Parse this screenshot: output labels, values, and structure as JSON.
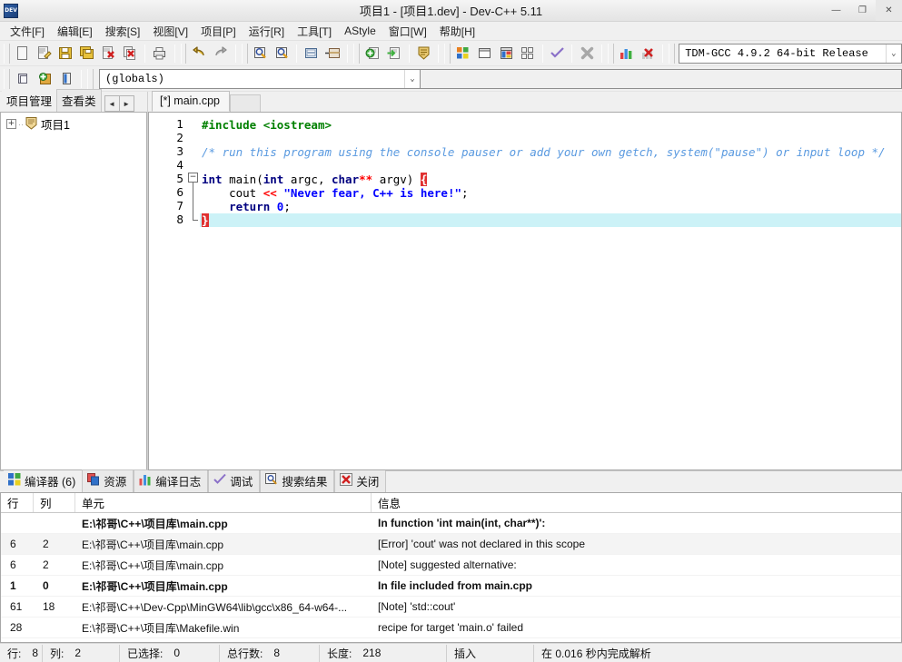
{
  "window": {
    "title": "项目1 - [项目1.dev] - Dev-C++ 5.11",
    "minimize": "—",
    "maximize": "❐",
    "close": "✕",
    "app_icon_text": "DEV"
  },
  "menubar": {
    "items": [
      {
        "label": "文件[F]",
        "name": "menu-file"
      },
      {
        "label": "编辑[E]",
        "name": "menu-edit"
      },
      {
        "label": "搜索[S]",
        "name": "menu-search"
      },
      {
        "label": "视图[V]",
        "name": "menu-view"
      },
      {
        "label": "项目[P]",
        "name": "menu-project"
      },
      {
        "label": "运行[R]",
        "name": "menu-run"
      },
      {
        "label": "工具[T]",
        "name": "menu-tools"
      },
      {
        "label": "AStyle",
        "name": "menu-astyle"
      },
      {
        "label": "窗口[W]",
        "name": "menu-window"
      },
      {
        "label": "帮助[H]",
        "name": "menu-help"
      }
    ]
  },
  "toolbar": {
    "compiler_combo_value": "TDM-GCC 4.9.2 64-bit Release",
    "globals_combo_value": "(globals)",
    "dropdown_arrow": "⌄",
    "icons": [
      "new-file-icon",
      "open-file-icon",
      "save-icon",
      "save-all-icon",
      "close-file-icon",
      "close-all-icon",
      "print-icon",
      "undo-icon",
      "redo-icon",
      "find-icon",
      "replace-icon",
      "goto-line-icon",
      "goto-function-icon",
      "add-to-project-icon",
      "remove-from-project-icon",
      "project-options-icon",
      "compile-icon",
      "run-icon",
      "compile-and-run-icon",
      "rebuild-all-icon",
      "syntax-check-icon",
      "stop-execution-icon",
      "profile-icon",
      "delete-profile-icon"
    ],
    "row2_icons": [
      "new-project-icon",
      "insert-icon",
      "toggle-icon"
    ]
  },
  "left_panel": {
    "tabs": [
      {
        "label": "项目管理",
        "name": "tab-project-manager",
        "active": true
      },
      {
        "label": "查看类",
        "name": "tab-class-browser",
        "active": false
      }
    ],
    "nav_prev": "◄",
    "nav_next": "►",
    "tree": {
      "expander": "+",
      "icon": "project-shield-icon",
      "label": "项目1"
    }
  },
  "editor": {
    "tabs": [
      {
        "label": "[*] main.cpp",
        "name": "tab-main-cpp",
        "active": true
      }
    ],
    "fold_collapse_glyph": "−",
    "lines": [
      {
        "number": "1",
        "selected": false,
        "tokens": [
          {
            "text": "#include ",
            "cls": "pre"
          },
          {
            "text": "<iostream>",
            "cls": "pre"
          }
        ]
      },
      {
        "number": "2",
        "selected": false,
        "tokens": []
      },
      {
        "number": "3",
        "selected": false,
        "tokens": [
          {
            "text": "/* run this program using the console pauser or add your own getch, system(\"pause\") or input loop */",
            "cls": "cmt"
          }
        ]
      },
      {
        "number": "4",
        "selected": false,
        "tokens": []
      },
      {
        "number": "5",
        "selected": false,
        "tokens": [
          {
            "text": "int",
            "cls": "kw"
          },
          {
            "text": " main(",
            "cls": "plain"
          },
          {
            "text": "int",
            "cls": "kw"
          },
          {
            "text": " argc, ",
            "cls": "plain"
          },
          {
            "text": "char",
            "cls": "kw"
          },
          {
            "text": "**",
            "cls": "op"
          },
          {
            "text": " argv) ",
            "cls": "plain"
          },
          {
            "text": "{",
            "cls": "brace"
          }
        ]
      },
      {
        "number": "6",
        "selected": false,
        "tokens": [
          {
            "text": "    cout ",
            "cls": "plain"
          },
          {
            "text": "<<",
            "cls": "op"
          },
          {
            "text": " ",
            "cls": "plain"
          },
          {
            "text": "\"Never fear, C++ is here!\"",
            "cls": "str"
          },
          {
            "text": ";",
            "cls": "plain"
          }
        ]
      },
      {
        "number": "7",
        "selected": false,
        "tokens": [
          {
            "text": "    ",
            "cls": "plain"
          },
          {
            "text": "return",
            "cls": "kw"
          },
          {
            "text": " ",
            "cls": "plain"
          },
          {
            "text": "0",
            "cls": "num"
          },
          {
            "text": ";",
            "cls": "plain"
          }
        ]
      },
      {
        "number": "8",
        "selected": true,
        "tokens": [
          {
            "text": "}",
            "cls": "brace"
          }
        ]
      }
    ]
  },
  "bottom_panel": {
    "tabs": [
      {
        "label": "编译器 (6)",
        "icon": "compiler-grid-icon",
        "name": "tab-compiler",
        "active": true
      },
      {
        "label": "资源",
        "icon": "resources-icon",
        "name": "tab-resources",
        "active": false
      },
      {
        "label": "编译日志",
        "icon": "compile-log-icon",
        "name": "tab-compile-log",
        "active": false
      },
      {
        "label": "调试",
        "icon": "debug-check-icon",
        "name": "tab-debug",
        "active": false
      },
      {
        "label": "搜索结果",
        "icon": "search-results-icon",
        "name": "tab-search-results",
        "active": false
      },
      {
        "label": "关闭",
        "icon": "close-panel-icon",
        "name": "tab-close",
        "active": false
      }
    ],
    "columns": [
      "行",
      "列",
      "单元",
      "信息"
    ],
    "rows": [
      {
        "line": "",
        "col": "",
        "unit": "E:\\祁哥\\C++\\项目库\\main.cpp",
        "message": "In function 'int main(int, char**)':",
        "bold": true,
        "alt": false
      },
      {
        "line": "6",
        "col": "2",
        "unit": "E:\\祁哥\\C++\\项目库\\main.cpp",
        "message": "[Error] 'cout' was not declared in this scope",
        "bold": false,
        "alt": true
      },
      {
        "line": "6",
        "col": "2",
        "unit": "E:\\祁哥\\C++\\项目库\\main.cpp",
        "message": "[Note] suggested alternative:",
        "bold": false,
        "alt": false
      },
      {
        "line": "1",
        "col": "0",
        "unit": "E:\\祁哥\\C++\\项目库\\main.cpp",
        "message": "In file included from main.cpp",
        "bold": true,
        "alt": false
      },
      {
        "line": "61",
        "col": "18",
        "unit": "E:\\祁哥\\C++\\Dev-Cpp\\MinGW64\\lib\\gcc\\x86_64-w64-...",
        "message": "[Note] 'std::cout'",
        "bold": false,
        "alt": false
      },
      {
        "line": "28",
        "col": "",
        "unit": "E:\\祁哥\\C++\\项目库\\Makefile.win",
        "message": "recipe for target 'main.o' failed",
        "bold": false,
        "alt": false
      }
    ]
  },
  "statusbar": {
    "row_label": "行:",
    "row_value": "8",
    "col_label": "列:",
    "col_value": "2",
    "selected_label": "已选择:",
    "selected_value": "0",
    "total_lines_label": "总行数:",
    "total_lines_value": "8",
    "length_label": "长度:",
    "length_value": "218",
    "insert_mode": "插入",
    "parse_status": "在 0.016 秒内完成解析"
  },
  "colors": {
    "chrome": "#f0f0f0",
    "editor_bg": "#ffffff",
    "selection": "#ccf2f7",
    "keyword": "#000080",
    "preprocessor": "#008000",
    "comment": "#5a9ae0",
    "string": "#0000ff",
    "operator": "#ff0000",
    "brace_highlight_bg": "#e03030"
  }
}
